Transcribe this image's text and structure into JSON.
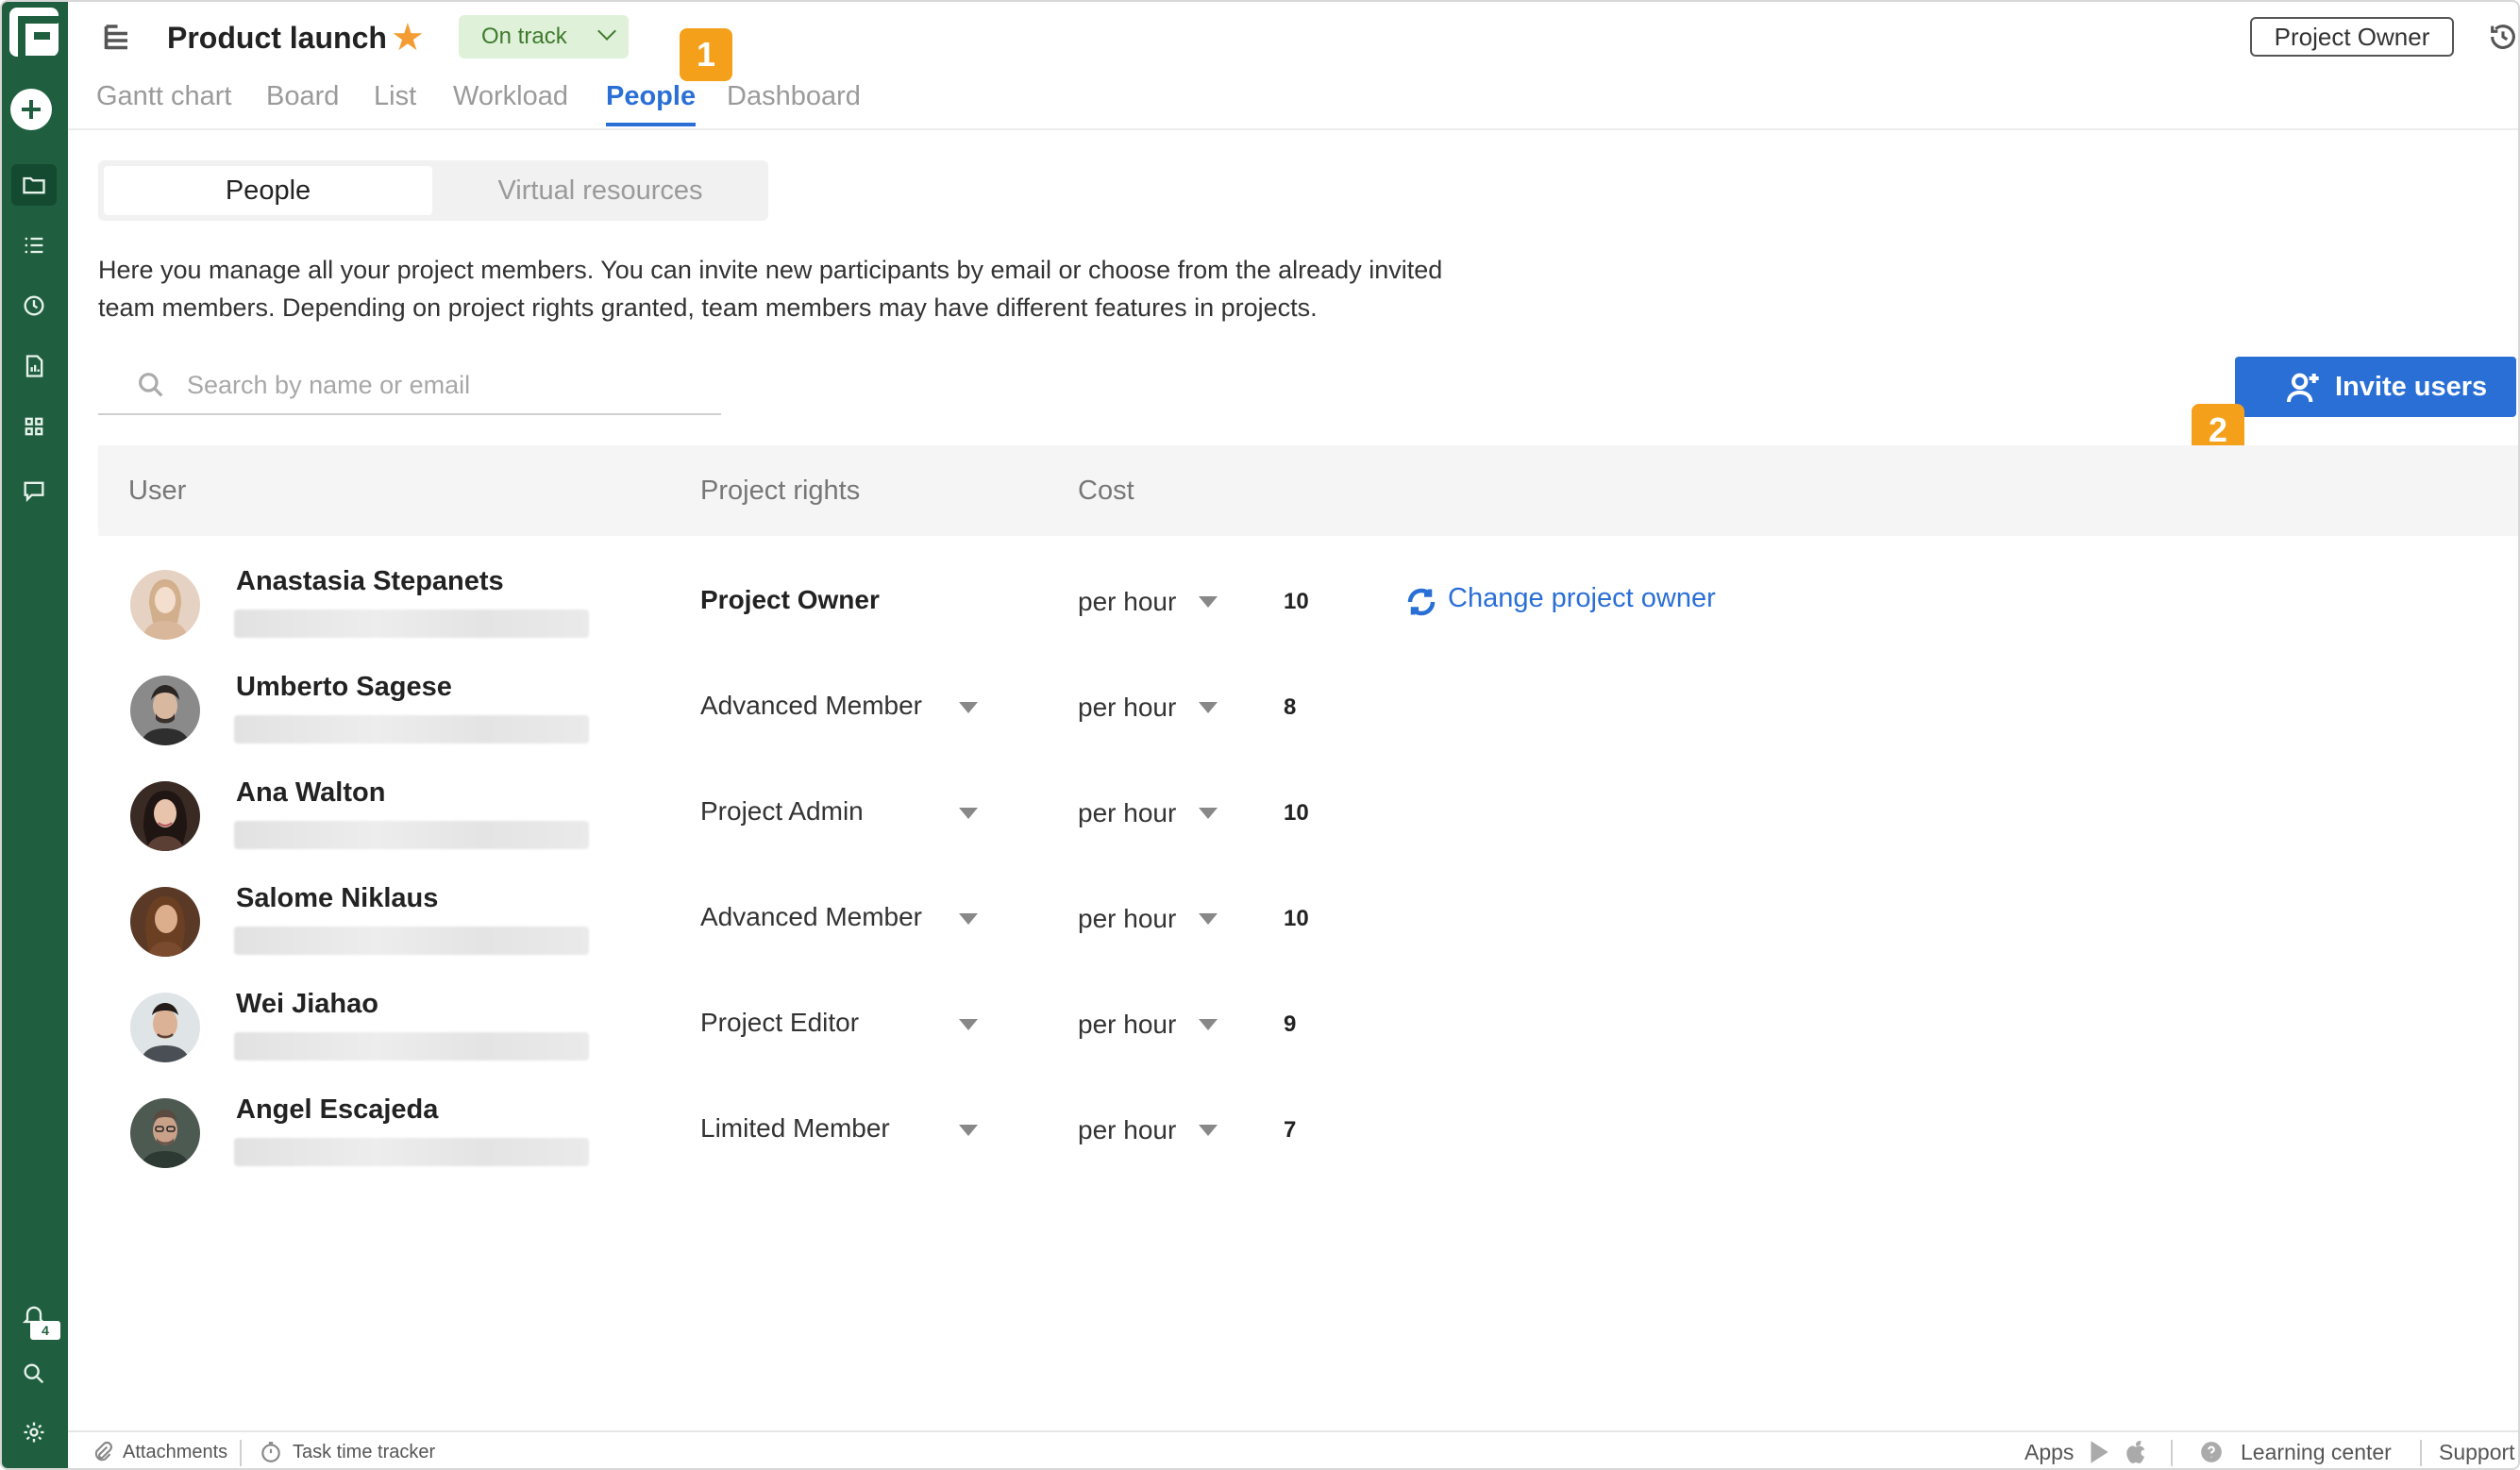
{
  "project": {
    "title": "Product launch",
    "status": "On track",
    "owner_button": "Project Owner"
  },
  "tabs": [
    {
      "label": "Gantt chart"
    },
    {
      "label": "Board"
    },
    {
      "label": "List"
    },
    {
      "label": "Workload"
    },
    {
      "label": "People"
    },
    {
      "label": "Dashboard"
    }
  ],
  "active_tab": "People",
  "callouts": [
    "1",
    "2"
  ],
  "segmented": {
    "people": "People",
    "virtual": "Virtual resources"
  },
  "description_line1": "Here you manage all your project members. You can invite new participants by email or choose from the already invited",
  "description_line2": "team members. Depending on project rights granted, team members may have different features in projects.",
  "search": {
    "placeholder": "Search by name or email"
  },
  "invite_label": "Invite users",
  "table": {
    "headers": {
      "user": "User",
      "rights": "Project rights",
      "cost": "Cost"
    },
    "rows": [
      {
        "name": "Anastasia Stepanets",
        "rights": "Project Owner",
        "cost_unit": "per hour",
        "cost": "10"
      },
      {
        "name": "Umberto Sagese",
        "rights": "Advanced Member",
        "cost_unit": "per hour",
        "cost": "8"
      },
      {
        "name": "Ana Walton",
        "rights": "Project Admin",
        "cost_unit": "per hour",
        "cost": "10"
      },
      {
        "name": "Salome Niklaus",
        "rights": "Advanced Member",
        "cost_unit": "per hour",
        "cost": "10"
      },
      {
        "name": "Wei Jiahao",
        "rights": "Project Editor",
        "cost_unit": "per hour",
        "cost": "9"
      },
      {
        "name": "Angel Escajeda",
        "rights": "Limited Member",
        "cost_unit": "per hour",
        "cost": "7"
      }
    ],
    "change_owner": "Change project owner"
  },
  "rail": {
    "notification_count": "4"
  },
  "footer": {
    "attachments": "Attachments",
    "time_tracker": "Task time tracker",
    "apps": "Apps",
    "learning": "Learning center",
    "support": "Support"
  },
  "colors": {
    "rail": "#1f5f3f",
    "accent": "#2a6fd6",
    "callout": "#f5a01a",
    "status_bg": "#dff1d8",
    "star": "#f39c33"
  }
}
